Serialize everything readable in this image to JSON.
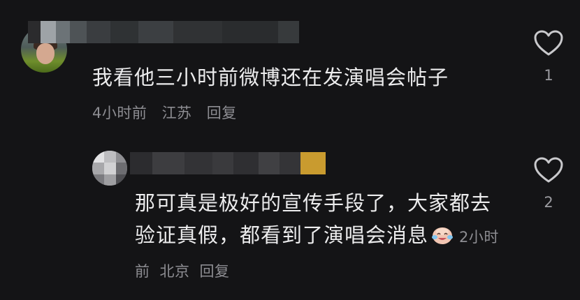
{
  "comments": [
    {
      "text": "我看他三小时前微博还在发演唱会帖子",
      "time": "4小时前",
      "location": "江苏",
      "reply_label": "回复",
      "like_count": "1"
    },
    {
      "text": "那可真是极好的宣传手段了，大家都去验证真假，都看到了演唱会消息",
      "time": "2小时前",
      "location": "北京",
      "reply_label": "回复",
      "like_count": "2"
    }
  ],
  "icons": {
    "like": "heart-outline-icon",
    "emoji": "crying-laughing-emoji-icon"
  },
  "colors": {
    "background": "#141416",
    "text": "#ececed",
    "meta_text": "#8d8d92"
  }
}
